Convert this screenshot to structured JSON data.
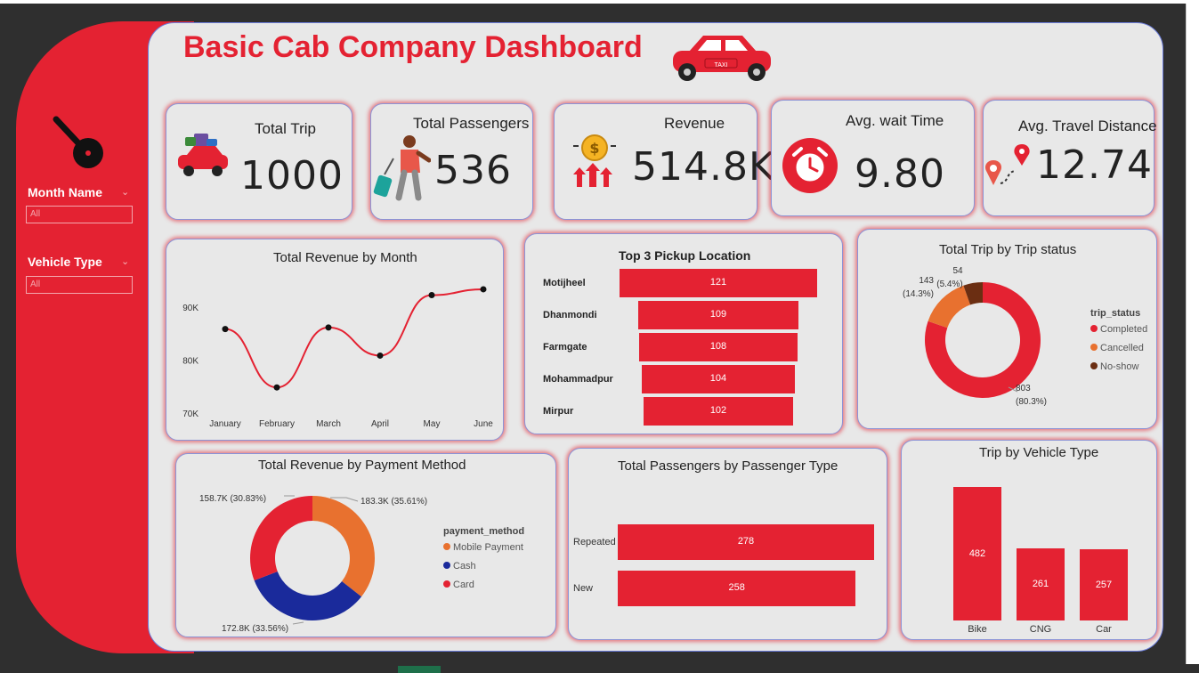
{
  "title": "Basic Cab Company Dashboard",
  "colors": {
    "accent": "#e42232",
    "orange": "#e8712f",
    "brown": "#6b2e12",
    "navy": "#1a2a9b"
  },
  "slicers": [
    {
      "label": "Month Name",
      "value": "All"
    },
    {
      "label": "Vehicle Type",
      "value": "All"
    }
  ],
  "kpis": {
    "total_trip": {
      "label": "Total Trip",
      "value": "1000"
    },
    "total_passengers": {
      "label": "Total Passengers",
      "value": "536"
    },
    "revenue": {
      "label": "Revenue",
      "value": "514.8K"
    },
    "avg_wait": {
      "label": "Avg. wait Time",
      "value": "9.80"
    },
    "avg_distance": {
      "label": "Avg. Travel Distance",
      "value": "12.74"
    }
  },
  "icons": {
    "taxi": "taxi-icon",
    "slicer": "pizza-cutter-icon",
    "car": "car-luggage-icon",
    "traveler": "traveler-icon",
    "coin": "revenue-coin-icon",
    "clock": "alarm-clock-icon",
    "route": "route-pin-icon",
    "taxi_sign": "TAXI"
  },
  "chart_data": [
    {
      "type": "line",
      "title": "Total Revenue by Month",
      "categories": [
        "January",
        "February",
        "March",
        "April",
        "May",
        "June"
      ],
      "values": [
        86.0,
        75.0,
        86.3,
        81.0,
        92.4,
        93.5
      ],
      "yticks": [
        "70K",
        "80K",
        "90K"
      ],
      "ylim": [
        70,
        95
      ]
    },
    {
      "type": "bar",
      "title": "Top 3 Pickup Location",
      "categories": [
        "Motijheel",
        "Dhanmondi",
        "Farmgate",
        "Mohammadpur",
        "Mirpur"
      ],
      "values": [
        121,
        109,
        108,
        104,
        102
      ]
    },
    {
      "type": "pie",
      "title": "Total Trip by Trip status",
      "legend_title": "trip_status",
      "categories": [
        "Completed",
        "Cancelled",
        "No-show"
      ],
      "values": [
        803,
        143,
        54
      ],
      "labels": [
        [
          "803",
          "(80.3%)"
        ],
        [
          "143",
          "(14.3%)"
        ],
        [
          "54",
          "(5.4%)"
        ]
      ]
    },
    {
      "type": "pie",
      "title": "Total Revenue by Payment Method",
      "legend_title": "payment_method",
      "categories": [
        "Mobile Payment",
        "Cash",
        "Card"
      ],
      "values": [
        183.3,
        172.8,
        158.7
      ],
      "labels": [
        "183.3K (35.61%)",
        "172.8K (33.56%)",
        "158.7K (30.83%)"
      ]
    },
    {
      "type": "bar",
      "title": "Total Passengers by Passenger Type",
      "categories": [
        "Repeated",
        "New"
      ],
      "values": [
        278,
        258
      ]
    },
    {
      "type": "bar",
      "title": "Trip by Vehicle Type",
      "categories": [
        "Bike",
        "CNG",
        "Car"
      ],
      "values": [
        482,
        261,
        257
      ]
    }
  ]
}
